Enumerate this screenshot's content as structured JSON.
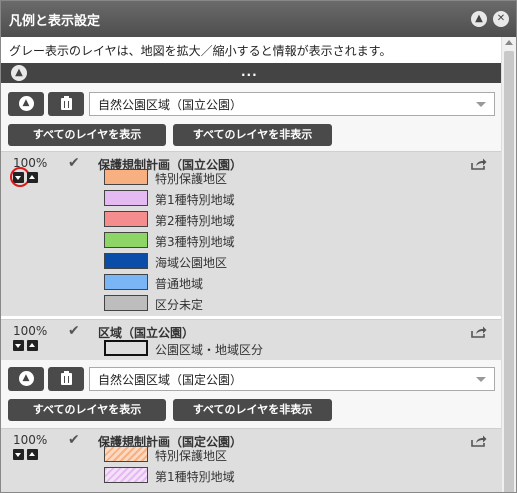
{
  "window": {
    "title": "凡例と表示設定",
    "notice": "グレー表示のレイヤは、地図を拡大／縮小すると情報が表示されます。",
    "collapse_dots": "..."
  },
  "groups": [
    {
      "select_value": "自然公園区域（国立公園）",
      "show_all": "すべてのレイヤを表示",
      "hide_all": "すべてのレイヤを非表示",
      "layers": [
        {
          "opacity": "100%",
          "name": "保護規制計画（国立公園）",
          "checked": true,
          "legend": [
            {
              "label": "特別保護地区",
              "color": "#F9B080"
            },
            {
              "label": "第1種特別地域",
              "color": "#E5B9F1"
            },
            {
              "label": "第2種特別地域",
              "color": "#F58C8E"
            },
            {
              "label": "第3種特別地域",
              "color": "#8ED568"
            },
            {
              "label": "海域公園地区",
              "color": "#0A4DA8"
            },
            {
              "label": "普通地域",
              "color": "#7AB6F5"
            },
            {
              "label": "区分未定",
              "color": "#BDBDBD"
            }
          ]
        },
        {
          "opacity": "100%",
          "name": "区域（国立公園）",
          "checked": true,
          "legend": [
            {
              "label": "公園区域・地域区分",
              "color": "#DEDEDE"
            }
          ]
        }
      ]
    },
    {
      "select_value": "自然公園区域（国定公園）",
      "show_all": "すべてのレイヤを表示",
      "hide_all": "すべてのレイヤを非表示",
      "layers": [
        {
          "opacity": "100%",
          "name": "保護規制計画（国定公園）",
          "checked": true,
          "legend": [
            {
              "label": "特別保護地区",
              "color": "#F9B080"
            },
            {
              "label": "第1種特別地域",
              "color": "#E5B9F1"
            }
          ]
        }
      ]
    }
  ],
  "colors": {
    "titlebar": "#555555",
    "button_dark": "#4A4A4A",
    "layer_bg": "#DEDEDE",
    "highlight_ring": "#E01818"
  }
}
